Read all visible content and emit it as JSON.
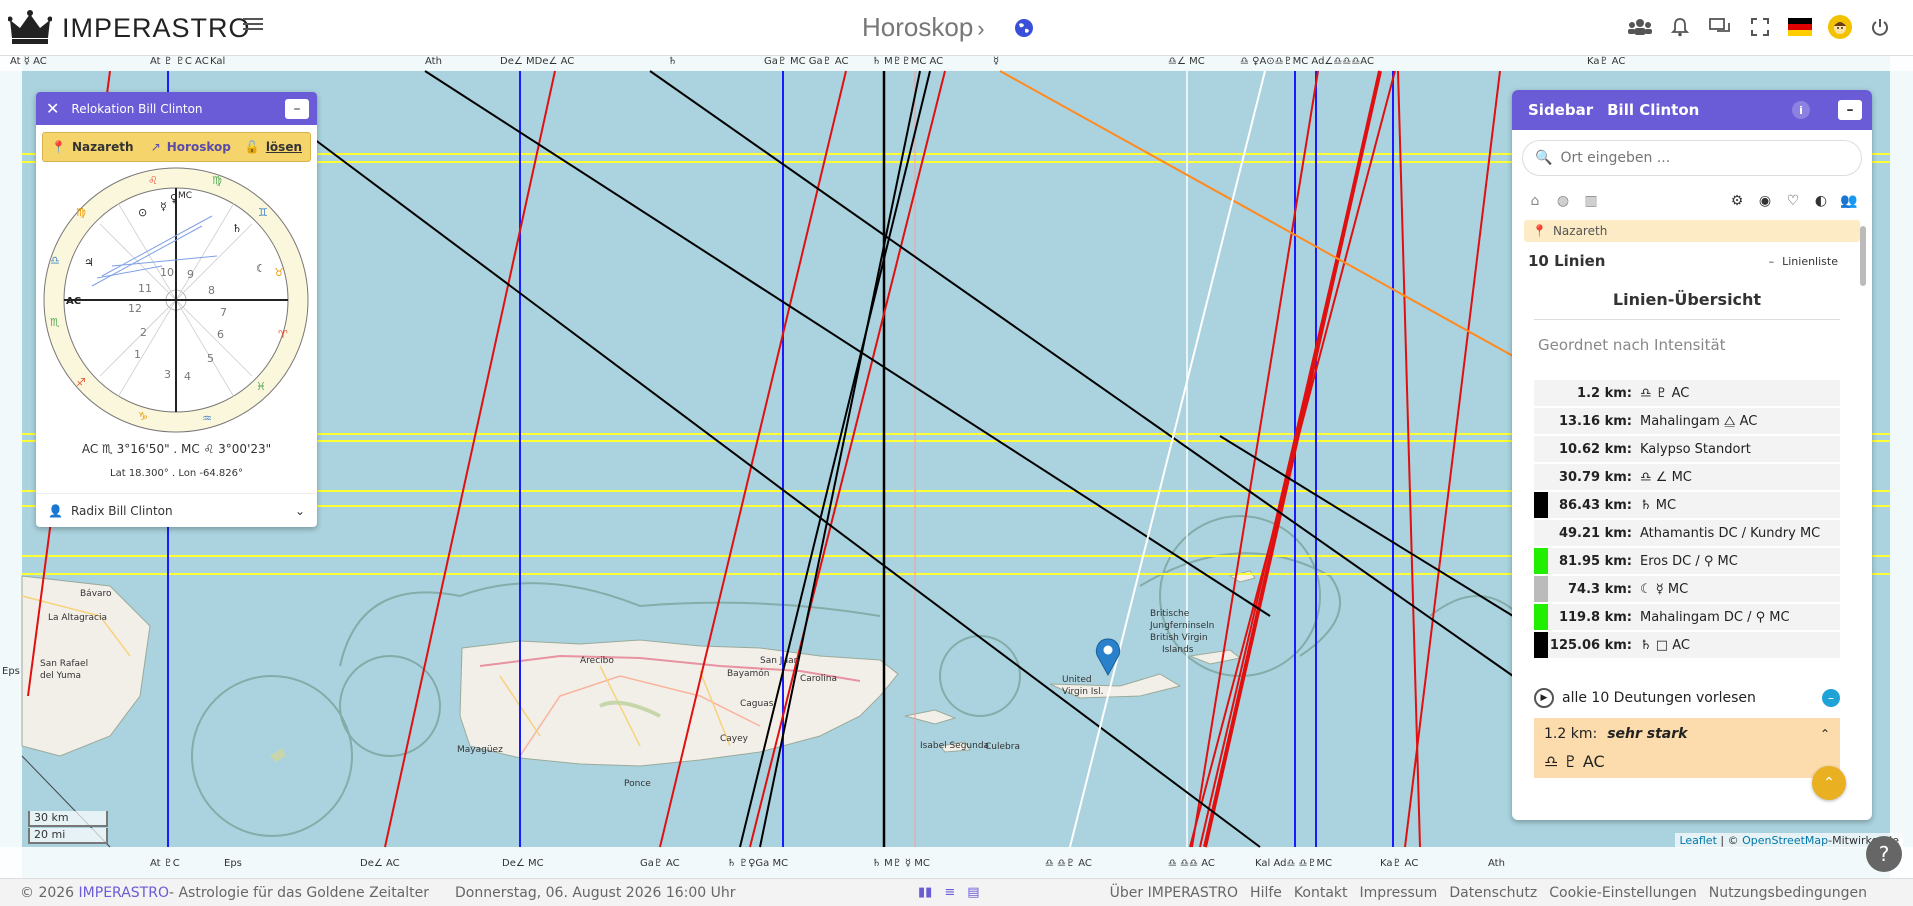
{
  "header": {
    "brand": "IMPERASTRO",
    "page_title": "Horoskop",
    "title_chevron": "›"
  },
  "top_axis_labels": [
    "At ☿ AC",
    "At ♇ ♇C AC",
    "Kal",
    "Ath",
    "De∠ MDe∠ AC",
    "♄",
    "Ga♇ MC Ga♇ AC",
    "♄ M♇♇MC AC",
    "☿",
    "♎∠ MC",
    "♎ ♀A⊙♎♇MC Ad∠♎♎♎AC",
    "Ka♇ AC"
  ],
  "bottom_axis_labels": [
    "At ♇C",
    "Eps",
    "De∠ AC",
    "De∠ MC",
    "Ga♇ AC",
    "♄ ♇♀Ga MC",
    "♄ M♇ ☿ MC",
    "♎ ♎♇ AC",
    "♎ ♎♎ AC",
    "Kal Ad♎ ♎♇MC",
    "Ka♇ AC",
    "Ath"
  ],
  "left_axis_labels": [
    "At ☿ AC",
    "Eps",
    "At ☿ AC"
  ],
  "relocation": {
    "title": "Relokation Bill Clinton",
    "close": "✕",
    "min": "–",
    "location": "Nazareth",
    "horoskop_link": "Horoskop",
    "loesen": "lösen",
    "ac_line": "AC ♏ 3°16'50\" . MC ♌ 3°00'23\"",
    "lat_lon": "Lat 18.300° . Lon -64.826°",
    "radix": "Radix Bill Clinton",
    "houses": [
      "1",
      "2",
      "3",
      "4",
      "5",
      "6",
      "7",
      "8",
      "9",
      "10",
      "11",
      "12"
    ],
    "ac_label": "AC",
    "mc_label": "MC"
  },
  "sidebar": {
    "title": "Sidebar",
    "person": "Bill Clinton",
    "min": "–",
    "info": "i",
    "search_placeholder": "Ort eingeben ...",
    "location": "Nazareth",
    "lines_count": "10 Linien",
    "lines_toggle": "–",
    "lines_list_label": "Linienliste",
    "overview_title": "Linien-Übersicht",
    "sort_label": "Geordnet nach Intensität",
    "rows": [
      {
        "color": "#f3f3f3",
        "km": "1.2 km:",
        "desc": "♎   ♇ AC"
      },
      {
        "color": "#f3f3f3",
        "km": "13.16 km:",
        "desc": "Mahalingam ⧋  AC"
      },
      {
        "color": "#f3f3f3",
        "km": "10.62 km:",
        "desc": "Kalypso Standort"
      },
      {
        "color": "#f3f3f3",
        "km": "30.79 km:",
        "desc": "♎   ∠  MC"
      },
      {
        "color": "#000000",
        "km": "86.43 km:",
        "desc": "♄  MC"
      },
      {
        "color": "#f3f3f3",
        "km": "49.21 km:",
        "desc": "Athamantis DC / Kundry MC"
      },
      {
        "color": "#22ee00",
        "km": "81.95 km:",
        "desc": "Eros DC / ⚲  MC"
      },
      {
        "color": "#bbbbbb",
        "km": "74.3 km:",
        "desc": "☾   ☿   MC"
      },
      {
        "color": "#22ee00",
        "km": "119.8 km:",
        "desc": "Mahalingam DC / ⚲  MC"
      },
      {
        "color": "#000000",
        "km": "125.06 km:",
        "desc": "♄   □   AC"
      }
    ],
    "read_all": "alle 10 Deutungen vorlesen",
    "first_km": "1.2 km:",
    "first_strength": "sehr stark",
    "first_symbols": "♎  ♇ AC"
  },
  "map": {
    "scale_km": "30 km",
    "scale_mi": "20 mi",
    "attribution_leaflet": "Leaflet",
    "attribution_sep": " | © ",
    "attribution_osm": "OpenStreetMap",
    "attribution_tail": "-Mitwirkende"
  },
  "footer": {
    "copyright": "© 2026",
    "brand": "IMPERASTRO",
    "tagline": "- Astrologie für das Goldene Zeitalter",
    "date": "Donnerstag, 06. August 2026 16:00 Uhr",
    "links": [
      "Über IMPERASTRO",
      "Hilfe",
      "Kontakt",
      "Impressum",
      "Datenschutz",
      "Cookie-Einstellungen",
      "Nutzungsbedingungen"
    ]
  },
  "colors": {
    "accent": "#6a5bd6",
    "water": "#aad3df",
    "location_bar": "#f5d46b",
    "fab": "#e9b121"
  }
}
